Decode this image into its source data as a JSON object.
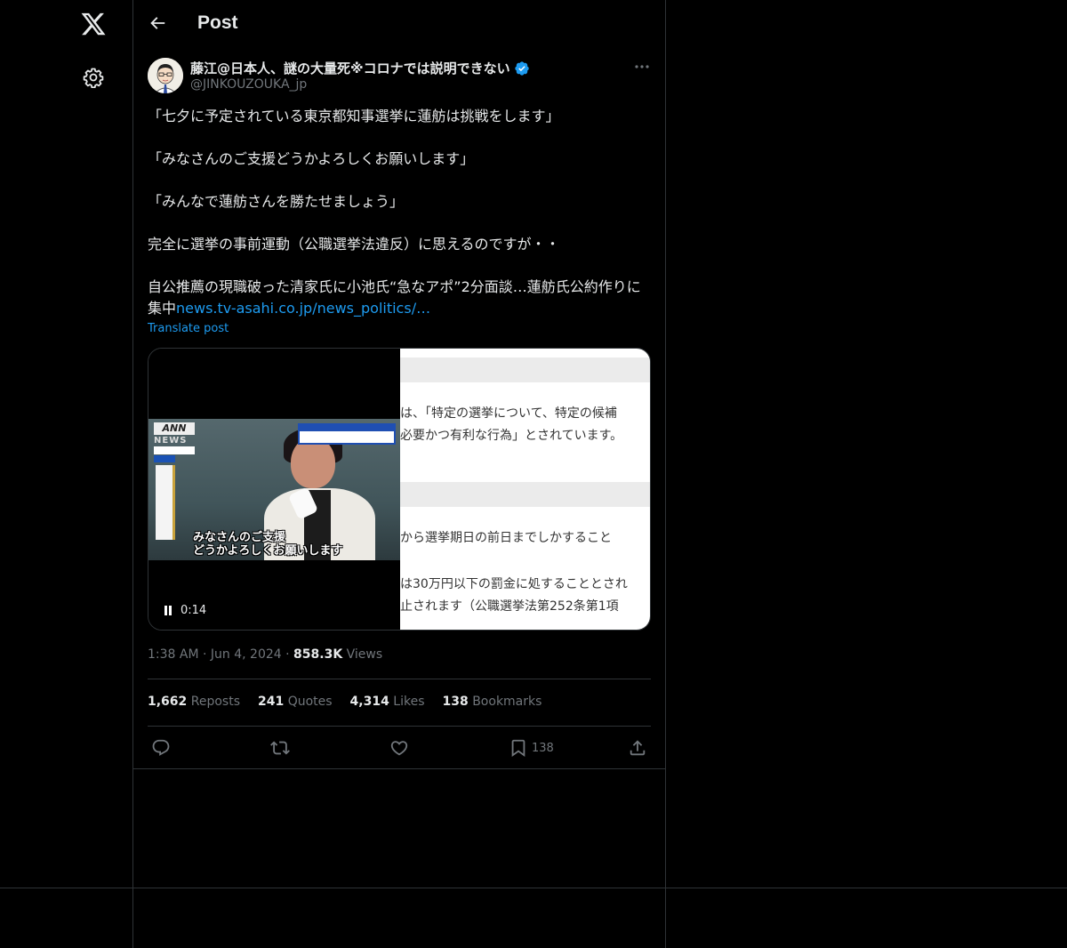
{
  "app": {
    "header_title": "Post"
  },
  "post": {
    "display_name": "藤江@日本人、謎の大量死※コロナでは説明できない",
    "handle": "@JINKOUZOUKA_jp",
    "lines": [
      "「七夕に予定されている東京都知事選挙に蓮舫は挑戦をします」",
      "「みなさんのご支援どうかよろしくお願いします」",
      "「みんなで蓮舫さんを勝たせましょう」",
      "完全に選挙の事前運動（公職選挙法違反）に思えるのですが・・",
      "自公推薦の現職破った清家氏に小池氏“急なアポ”2分面談…蓮舫氏公約作りに集中"
    ],
    "link_text": "news.tv-asahi.co.jp/news_politics/…",
    "translate_label": "Translate post",
    "time": "1:38 AM",
    "date": "Jun 4, 2024",
    "views_count": "858.3K",
    "views_label": "Views",
    "stats": {
      "reposts_count": "1,662",
      "reposts_label": "Reposts",
      "quotes_count": "241",
      "quotes_label": "Quotes",
      "likes_count": "4,314",
      "likes_label": "Likes",
      "bookmarks_count": "138",
      "bookmarks_label": "Bookmarks"
    },
    "bookmark_action_count": "138"
  },
  "media": {
    "video_time": "0:14",
    "news_logo": "ANN",
    "news_word": "NEWS",
    "caption_line1": "みなさんのご支援",
    "caption_line2": "どうかよろしくお願いします",
    "article_lines": [
      "は、「特定の選挙について、特定の候補",
      "必要かつ有利な行為」とされています。",
      "から選挙期日の前日までしかすること",
      "は30万円以下の罰金に処することとされ",
      "止されます（公職選挙法第252条第1項"
    ]
  },
  "icons": {
    "logo": "x-logo-icon",
    "settings": "gear-icon",
    "back": "arrow-left-icon",
    "verified": "verified-badge-icon",
    "more": "more-horizontal-icon",
    "reply": "reply-icon",
    "repost": "repost-icon",
    "like": "heart-icon",
    "bookmark": "bookmark-icon",
    "share": "share-icon",
    "pause": "pause-icon"
  },
  "colors": {
    "background": "#000000",
    "text": "#e7e9ea",
    "secondary": "#71767b",
    "accent": "#1d9bf0",
    "border": "#2f3336"
  }
}
